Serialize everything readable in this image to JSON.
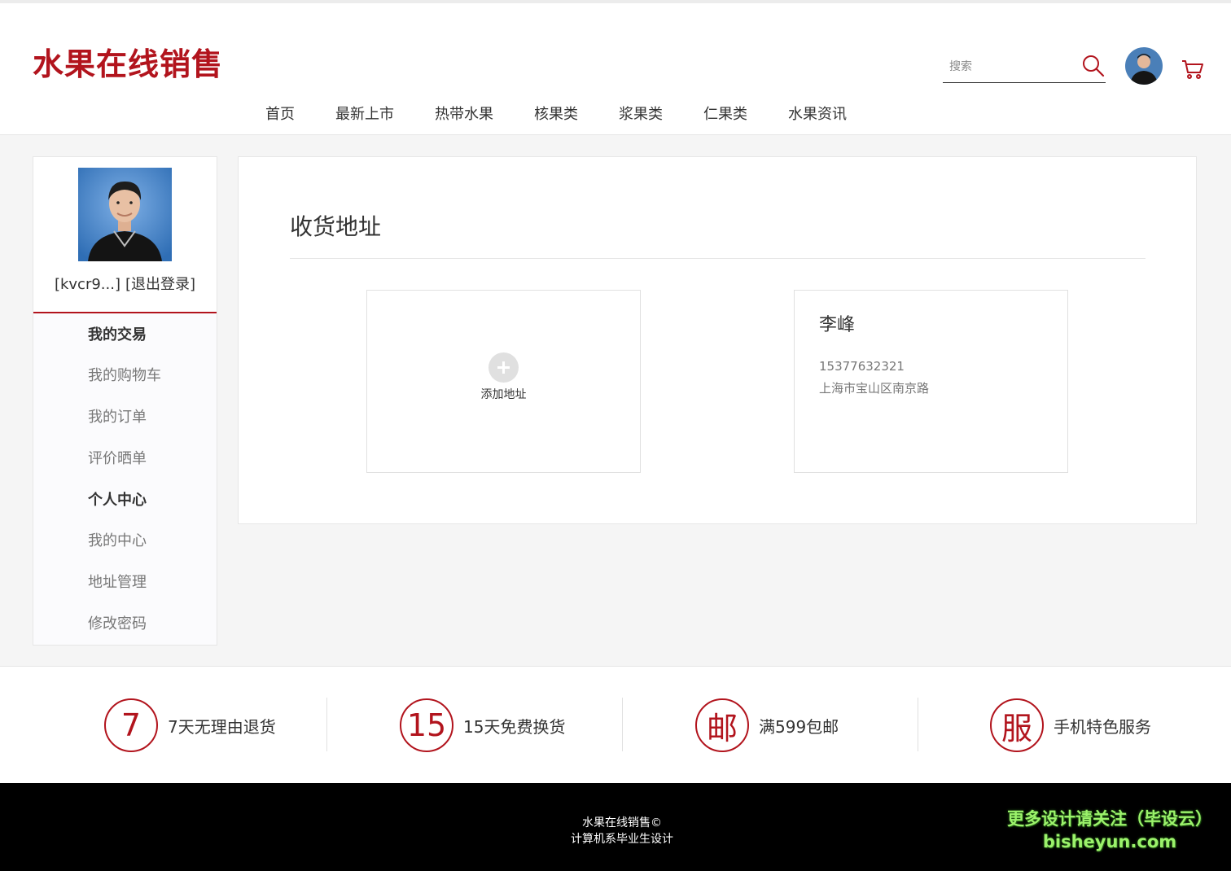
{
  "header": {
    "logo": "水果在线销售",
    "search": {
      "placeholder": "搜索"
    },
    "nav": [
      "首页",
      "最新上市",
      "热带水果",
      "核果类",
      "浆果类",
      "仁果类",
      "水果资讯"
    ]
  },
  "sidebar": {
    "username": "[kvcr9...]",
    "logout_label": "[退出登录]",
    "menu": {
      "group_trade": "我的交易",
      "cart": "我的购物车",
      "orders": "我的订单",
      "reviews": "评价晒单",
      "group_personal": "个人中心",
      "center": "我的中心",
      "address": "地址管理",
      "password": "修改密码"
    }
  },
  "main": {
    "title": "收货地址",
    "add_label": "添加地址",
    "address_card": {
      "name": "李峰",
      "phone": "15377632321",
      "address": "上海市宝山区南京路"
    }
  },
  "services": [
    {
      "glyph": "7",
      "text": "7天无理由退货"
    },
    {
      "glyph": "15",
      "text": "15天免费换货"
    },
    {
      "glyph": "邮",
      "text": "满599包邮"
    },
    {
      "glyph": "服",
      "text": "手机特色服务"
    }
  ],
  "footer": {
    "line1": "水果在线销售©",
    "line2": "计算机系毕业生设计",
    "watermark_line1": "更多设计请关注（毕设云）",
    "watermark_line2": "bisheyun.com"
  },
  "colors": {
    "brand": "#b2141d",
    "watermark": "#9bf26b"
  }
}
